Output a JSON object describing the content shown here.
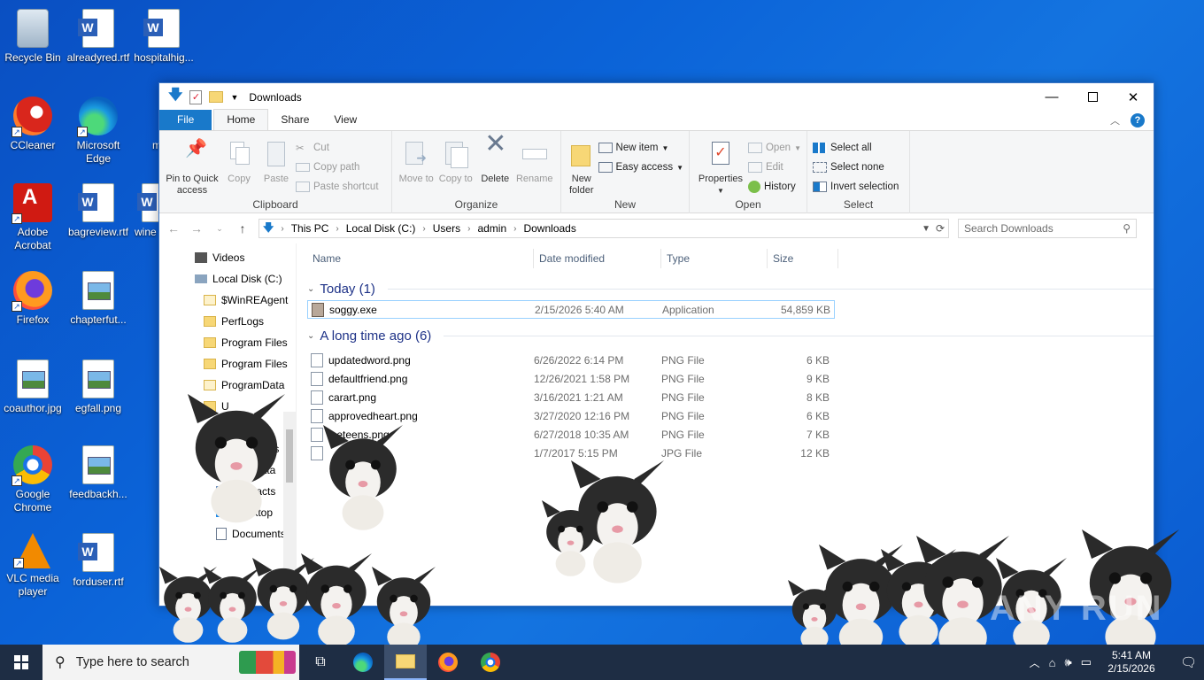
{
  "desktop": {
    "icons": [
      {
        "label": "Recycle Bin",
        "icon": "recycle-bin-icon"
      },
      {
        "label": "alreadyred.rtf",
        "icon": "word-document-icon"
      },
      {
        "label": "hospitalhig...",
        "icon": "word-document-icon"
      },
      {
        "label": "CCleaner",
        "icon": "ccleaner-icon"
      },
      {
        "label": "Microsoft Edge",
        "icon": "edge-icon"
      },
      {
        "label": "male",
        "icon": "word-document-icon"
      },
      {
        "label": "Adobe Acrobat",
        "icon": "acrobat-icon"
      },
      {
        "label": "bagreview.rtf",
        "icon": "word-document-icon"
      },
      {
        "label": "wine",
        "icon": "word-document-icon"
      },
      {
        "label": "Firefox",
        "icon": "firefox-icon"
      },
      {
        "label": "chapterfut...",
        "icon": "image-file-icon"
      },
      {
        "label": "coauthor.jpg",
        "icon": "image-file-icon"
      },
      {
        "label": "egfall.png",
        "icon": "image-file-icon"
      },
      {
        "label": "Google Chrome",
        "icon": "chrome-icon"
      },
      {
        "label": "feedbackh...",
        "icon": "image-file-icon"
      },
      {
        "label": "VLC media player",
        "icon": "vlc-icon"
      },
      {
        "label": "forduser.rtf",
        "icon": "word-document-icon"
      }
    ]
  },
  "window": {
    "title": "Downloads",
    "tabs": {
      "file": "File",
      "home": "Home",
      "share": "Share",
      "view": "View"
    },
    "ribbon": {
      "clipboard": {
        "label": "Clipboard",
        "pin": "Pin to Quick access",
        "copy": "Copy",
        "paste": "Paste",
        "cut": "Cut",
        "copy_path": "Copy path",
        "paste_shortcut": "Paste shortcut"
      },
      "organize": {
        "label": "Organize",
        "move_to": "Move to",
        "copy_to": "Copy to",
        "delete": "Delete",
        "rename": "Rename"
      },
      "new": {
        "label": "New",
        "new_folder": "New folder",
        "new_item": "New item",
        "easy_access": "Easy access"
      },
      "open": {
        "label": "Open",
        "properties": "Properties",
        "open": "Open",
        "edit": "Edit",
        "history": "History"
      },
      "select": {
        "label": "Select",
        "select_all": "Select all",
        "select_none": "Select none",
        "invert": "Invert selection"
      }
    },
    "address": {
      "crumbs": [
        "This PC",
        "Local Disk (C:)",
        "Users",
        "admin",
        "Downloads"
      ],
      "search_placeholder": "Search Downloads"
    },
    "nav": [
      "Videos",
      "Local Disk (C:)",
      "$WinREAgent",
      "PerfLogs",
      "Program Files",
      "Program Files",
      "ProgramData",
      "U",
      "d",
      "bjects",
      "Data",
      "Contacts",
      "Desktop",
      "Documents"
    ],
    "columns": {
      "name": "Name",
      "date": "Date modified",
      "type": "Type",
      "size": "Size"
    },
    "groups": [
      {
        "title": "Today (1)",
        "files": [
          {
            "name": "soggy.exe",
            "date": "2/15/2026 5:40 AM",
            "type": "Application",
            "size": "54,859 KB"
          }
        ]
      },
      {
        "title": "A long time ago (6)",
        "files": [
          {
            "name": "updatedword.png",
            "date": "6/26/2022 6:14 PM",
            "type": "PNG File",
            "size": "6 KB"
          },
          {
            "name": "defaultfriend.png",
            "date": "12/26/2021 1:58 PM",
            "type": "PNG File",
            "size": "9 KB"
          },
          {
            "name": "carart.png",
            "date": "3/16/2021 1:21 AM",
            "type": "PNG File",
            "size": "8 KB"
          },
          {
            "name": "approvedheart.png",
            "date": "3/27/2020 12:16 PM",
            "type": "PNG File",
            "size": "6 KB"
          },
          {
            "name": "leeteens.png",
            "date": "6/27/2018 10:35 AM",
            "type": "PNG File",
            "size": "7 KB"
          },
          {
            "name": "jpg",
            "date": "1/7/2017 5:15 PM",
            "type": "JPG File",
            "size": "12 KB"
          }
        ]
      }
    ]
  },
  "taskbar": {
    "search_placeholder": "Type here to search",
    "time": "5:41 AM",
    "date": "2/15/2026"
  },
  "watermark": "ANY RUN"
}
